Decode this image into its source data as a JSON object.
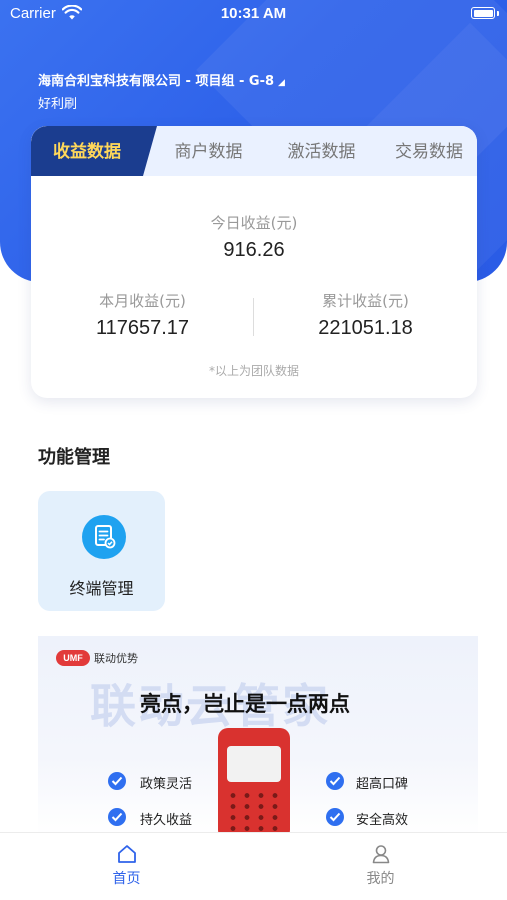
{
  "status_bar": {
    "carrier": "Carrier",
    "time": "10:31 AM"
  },
  "header": {
    "company": "海南合利宝科技有限公司 - 项目组 - G-8",
    "app_name": "好利刷"
  },
  "data_card": {
    "tabs": [
      {
        "label": "收益数据",
        "active": true
      },
      {
        "label": "商户数据",
        "active": false
      },
      {
        "label": "激活数据",
        "active": false
      },
      {
        "label": "交易数据",
        "active": false
      }
    ],
    "today": {
      "label": "今日收益(元)",
      "value": "916.26"
    },
    "month": {
      "label": "本月收益(元)",
      "value": "117657.17"
    },
    "total": {
      "label": "累计收益(元)",
      "value": "221051.18"
    },
    "footnote": "*以上为团队数据"
  },
  "functions": {
    "title": "功能管理",
    "items": [
      {
        "label": "终端管理",
        "icon": "document-icon"
      }
    ]
  },
  "banner": {
    "logo": "UMF",
    "brand": "联动优势",
    "watermark": "联动云管家",
    "headline": "亮点，岂止是一点两点",
    "features": [
      "政策灵活",
      "超高口碑",
      "持久收益",
      "安全高效"
    ]
  },
  "tabbar": {
    "items": [
      {
        "label": "首页",
        "icon": "home-icon",
        "active": true
      },
      {
        "label": "我的",
        "icon": "profile-icon",
        "active": false
      }
    ]
  },
  "colors": {
    "primary": "#2f63ea",
    "tab_active_bg": "#1b3d8f",
    "tab_active_text": "#ffd85a",
    "accent_blue": "#1fa2f0"
  }
}
